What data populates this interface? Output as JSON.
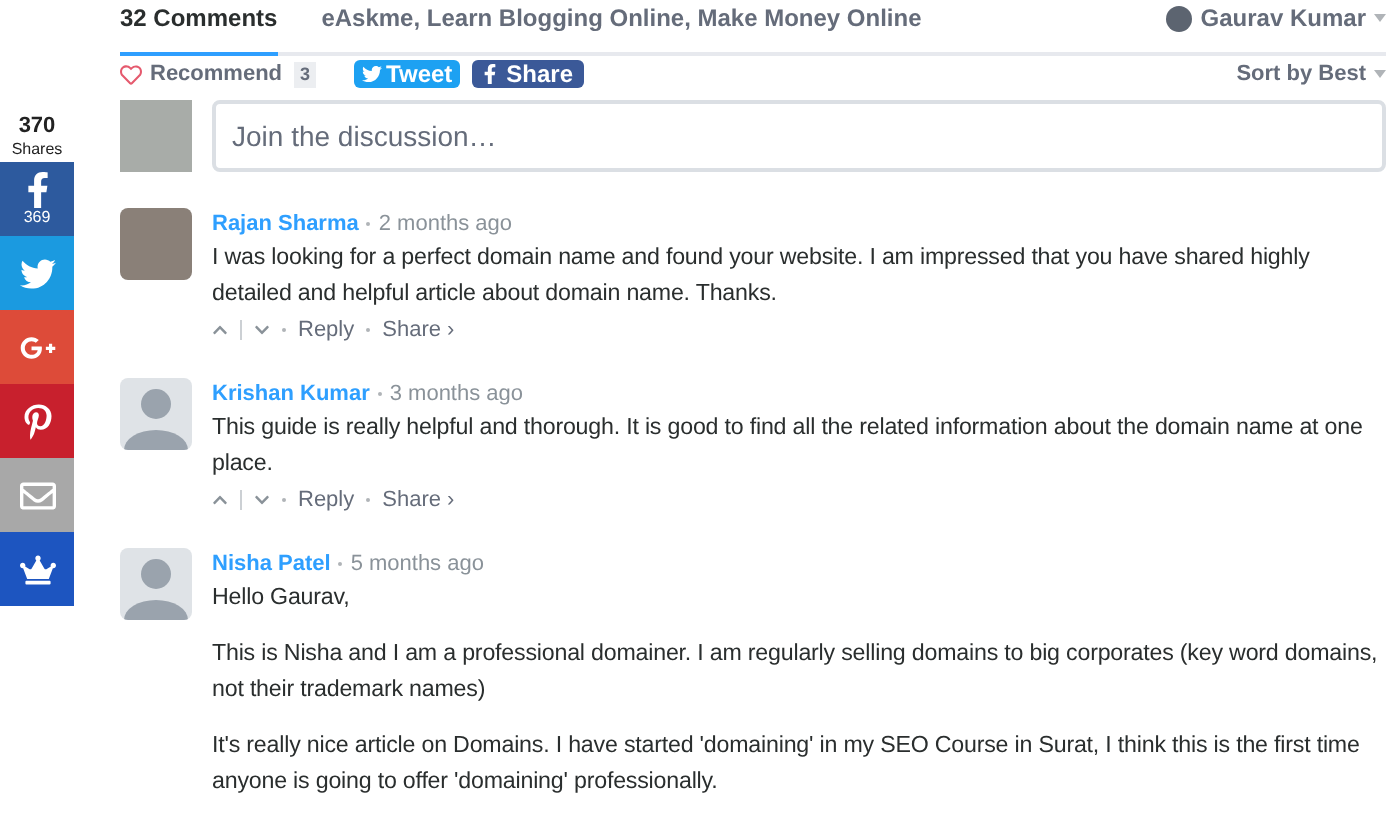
{
  "share_bar": {
    "total": "370",
    "total_label": "Shares",
    "buttons": [
      {
        "kind": "facebook",
        "count": "369"
      },
      {
        "kind": "twitter"
      },
      {
        "kind": "googleplus"
      },
      {
        "kind": "pinterest"
      },
      {
        "kind": "email"
      },
      {
        "kind": "crown"
      }
    ]
  },
  "tabs": [
    {
      "label": "32 Comments",
      "selected": true
    },
    {
      "label": "eAskme, Learn Blogging Online, Make Money Online",
      "selected": false
    }
  ],
  "user_menu": {
    "name": "Gaurav Kumar"
  },
  "toolbar": {
    "recommend": "Recommend",
    "recommend_count": "3",
    "tweet": "Tweet",
    "share": "Share",
    "sort": "Sort by Best"
  },
  "composer": {
    "placeholder": "Join the discussion…"
  },
  "comments": [
    {
      "author": "Rajan Sharma",
      "time": "2 months ago",
      "avatar": {
        "kind": "photo"
      },
      "paragraphs": [
        "I was looking for a perfect domain name and found your website. I am impressed that you have shared highly detailed and helpful article about domain name. Thanks."
      ],
      "reply": "Reply",
      "share": "Share ›"
    },
    {
      "author": "Krishan Kumar",
      "time": "3 months ago",
      "avatar": {
        "kind": "default"
      },
      "paragraphs": [
        "This guide is really helpful and thorough. It is good to find all the related information about the domain name at one place."
      ],
      "reply": "Reply",
      "share": "Share ›"
    },
    {
      "author": "Nisha Patel",
      "time": "5 months ago",
      "avatar": {
        "kind": "default"
      },
      "paragraphs": [
        "Hello Gaurav,",
        "This is Nisha and I am a professional domainer. I am regularly selling domains to big corporates (key word domains, not their trademark names)",
        "It's really nice article on Domains. I have started 'domaining' in my SEO Course in Surat, I think this is the first time anyone is going to offer 'domaining' professionally."
      ]
    }
  ]
}
